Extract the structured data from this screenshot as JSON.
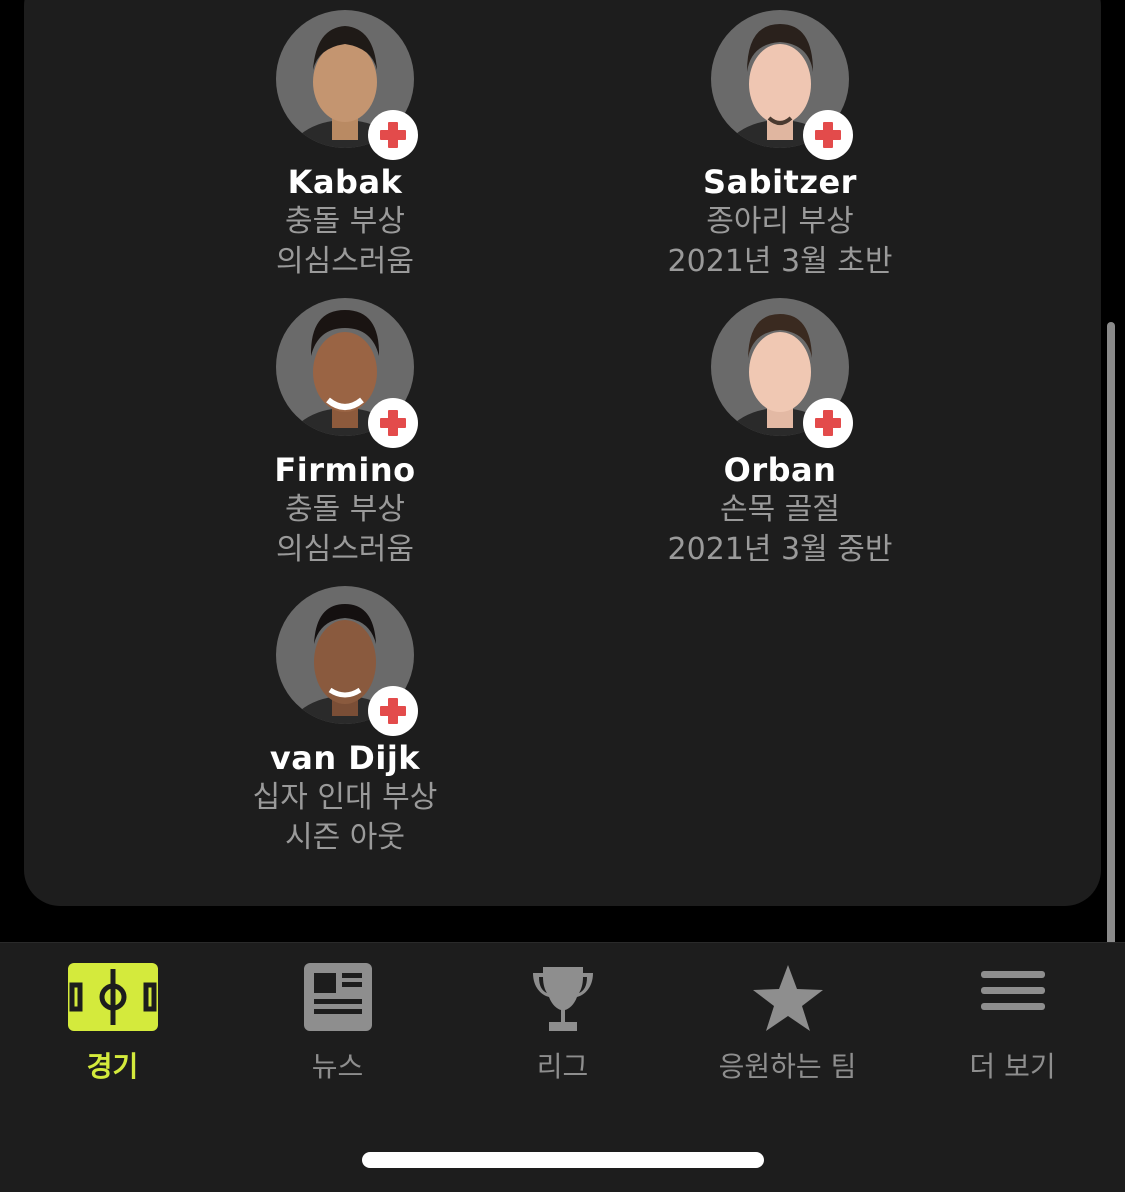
{
  "players": [
    {
      "name": "Kabak",
      "injury": "충돌 부상",
      "status": "의심스러움"
    },
    {
      "name": "Sabitzer",
      "injury": "종아리 부상",
      "status": "2021년 3월 초반"
    },
    {
      "name": "Firmino",
      "injury": "충돌 부상",
      "status": "의심스러움"
    },
    {
      "name": "Orban",
      "injury": "손목 골절",
      "status": "2021년 3월 중반"
    },
    {
      "name": "van Dijk",
      "injury": "십자 인대 부상",
      "status": "시즌 아웃"
    }
  ],
  "tabs": [
    {
      "label": "경기",
      "icon": "pitch-icon",
      "active": true
    },
    {
      "label": "뉴스",
      "icon": "newspaper-icon",
      "active": false
    },
    {
      "label": "리그",
      "icon": "trophy-icon",
      "active": false
    },
    {
      "label": "응원하는 팀",
      "icon": "star-icon",
      "active": false
    },
    {
      "label": "더 보기",
      "icon": "menu-icon",
      "active": false
    }
  ],
  "colors": {
    "accent": "#d4ea3c",
    "card_bg": "#1d1d1d",
    "injury_red": "#e34b4b",
    "muted_text": "#9a9a9a"
  }
}
